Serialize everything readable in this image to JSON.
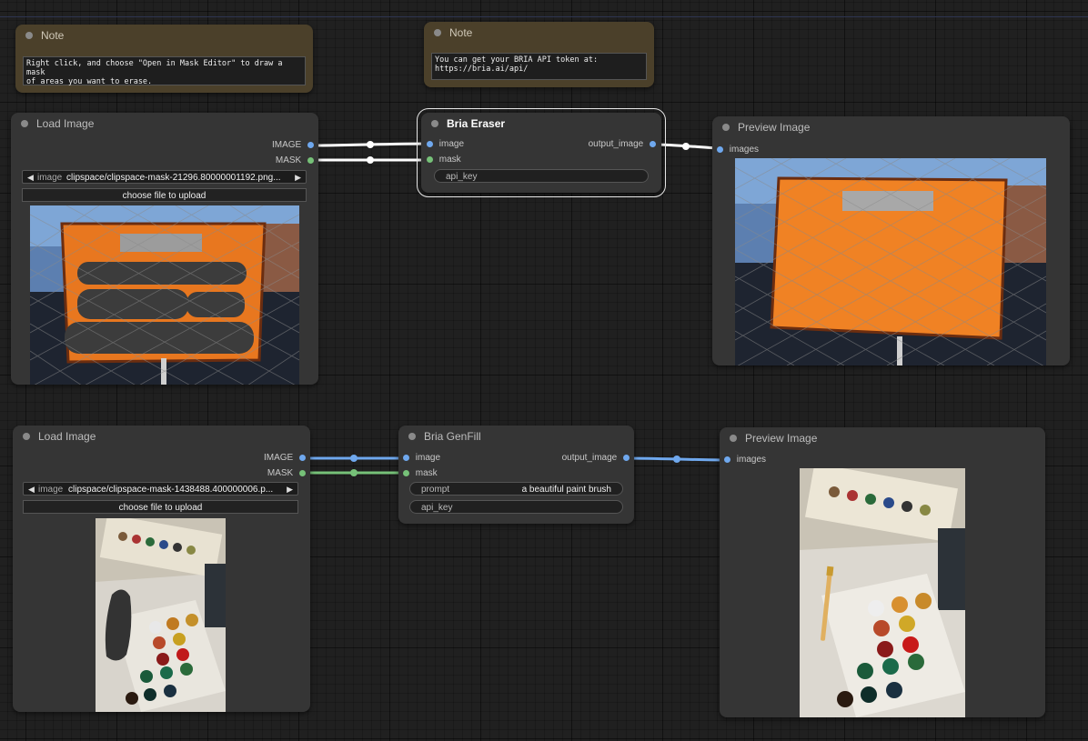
{
  "notes": [
    {
      "title": "Note",
      "text": "Right click, and choose \"Open in Mask Editor\" to draw a mask\nof areas you want to erase."
    },
    {
      "title": "Note",
      "text": "You can get your BRIA API token at:\nhttps://bria.ai/api/"
    }
  ],
  "load_image_1": {
    "title": "Load Image",
    "outputs": [
      "IMAGE",
      "MASK"
    ],
    "combo_label": "image",
    "combo_value": "clipspace/clipspace-mask-21296.80000001192.png...",
    "upload_label": "choose file to upload"
  },
  "bria_eraser": {
    "title": "Bria Eraser",
    "inputs": [
      "image",
      "mask"
    ],
    "output": "output_image",
    "api_key_label": "api_key"
  },
  "preview_1": {
    "title": "Preview Image",
    "input": "images"
  },
  "load_image_2": {
    "title": "Load Image",
    "outputs": [
      "IMAGE",
      "MASK"
    ],
    "combo_label": "image",
    "combo_value": "clipspace/clipspace-mask-1438488.400000006.p...",
    "upload_label": "choose file to upload"
  },
  "bria_genfill": {
    "title": "Bria GenFill",
    "inputs": [
      "image",
      "mask"
    ],
    "output": "output_image",
    "prompt_label": "prompt",
    "prompt_value": "a beautiful paint brush",
    "api_key_label": "api_key"
  },
  "preview_2": {
    "title": "Preview Image",
    "input": "images"
  },
  "colors": {
    "canvas": "#202020",
    "node": "#353535",
    "note": "#4b402a",
    "image_link": "#6fa8ee",
    "mask_link": "#76c178",
    "selected_link": "#ffffff"
  },
  "icons": {
    "combo_left": "left-triangle-icon",
    "combo_right": "right-triangle-icon"
  }
}
